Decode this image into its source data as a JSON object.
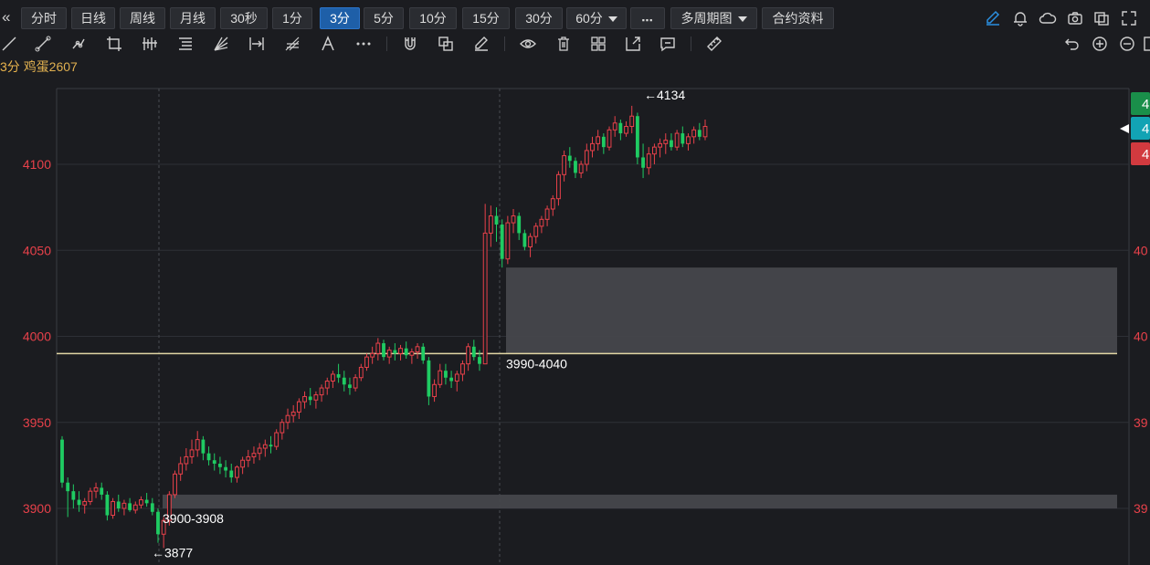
{
  "toolbar": {
    "periods": [
      {
        "label": "分时"
      },
      {
        "label": "日线"
      },
      {
        "label": "周线"
      },
      {
        "label": "月线"
      },
      {
        "label": "30秒"
      },
      {
        "label": "1分"
      },
      {
        "label": "3分",
        "active": true
      },
      {
        "label": "5分"
      },
      {
        "label": "10分"
      },
      {
        "label": "15分"
      },
      {
        "label": "30分"
      },
      {
        "label": "60分"
      }
    ],
    "more_label": "▪▪▪",
    "multi_period_label": "多周期图",
    "contract_info_label": "合约资料"
  },
  "symbol": {
    "period": "3分",
    "name": "鸡蛋2607"
  },
  "colors": {
    "background": "#1b1c20",
    "up": "#e8414a",
    "down": "#1fcb62",
    "grid": "#2e3036",
    "accent": "#1e5fa8",
    "zone": "#46474c",
    "level_line": "#e2d6a4",
    "price_text": "#e8414a"
  },
  "icons": {
    "drawing": [
      "line-tool-icon",
      "ray-tool-icon",
      "polyline-tool-icon",
      "crop-tool-icon",
      "bars-tool-icon",
      "fib-tool-icon",
      "fan-tool-icon",
      "measure-range-icon",
      "pitchfork-icon",
      "text-tool-icon",
      "more-tools-icon",
      "magnet-icon",
      "copy-icon",
      "eraser-icon",
      "eye-icon",
      "trash-icon",
      "layers-icon",
      "export-icon",
      "comment-icon",
      "ruler-icon"
    ],
    "right": [
      "pencil-icon",
      "bell-icon",
      "cloud-icon",
      "camera-icon",
      "window-icon",
      "expand-icon"
    ]
  },
  "chart_data": {
    "type": "candlestick",
    "y_ticks": [
      "4100",
      "4050",
      "4000",
      "3950",
      "3900"
    ],
    "ylim": [
      3867,
      4144
    ],
    "zones": [
      {
        "label": "3990-4040",
        "low": 3990,
        "high": 4040
      },
      {
        "label": "3900-3908",
        "low": 3900,
        "high": 3908
      }
    ],
    "level_line": 3990,
    "annotations": [
      {
        "label": "←4134",
        "value": 4134
      },
      {
        "label": "←3877",
        "value": 3877
      }
    ],
    "right_axis_partial": [
      "40",
      "40",
      "39",
      "39"
    ],
    "price_tags": [
      {
        "label": "4",
        "color": "#1a8f4a"
      },
      {
        "label": "4",
        "color": "#12a3b4"
      },
      {
        "label": "4",
        "color": "#d23a3f"
      }
    ],
    "candles": [
      [
        3940,
        3942,
        3912,
        3915
      ],
      [
        3915,
        3918,
        3895,
        3910
      ],
      [
        3910,
        3914,
        3900,
        3905
      ],
      [
        3905,
        3910,
        3898,
        3902
      ],
      [
        3902,
        3906,
        3897,
        3904
      ],
      [
        3904,
        3912,
        3902,
        3910
      ],
      [
        3910,
        3915,
        3906,
        3912
      ],
      [
        3912,
        3915,
        3905,
        3908
      ],
      [
        3908,
        3910,
        3893,
        3896
      ],
      [
        3896,
        3906,
        3894,
        3904
      ],
      [
        3904,
        3908,
        3898,
        3900
      ],
      [
        3900,
        3905,
        3896,
        3903
      ],
      [
        3903,
        3906,
        3898,
        3899
      ],
      [
        3899,
        3904,
        3897,
        3902
      ],
      [
        3902,
        3907,
        3900,
        3905
      ],
      [
        3905,
        3909,
        3901,
        3903
      ],
      [
        3903,
        3906,
        3896,
        3898
      ],
      [
        3898,
        3900,
        3880,
        3885
      ],
      [
        3885,
        3895,
        3877,
        3893
      ],
      [
        3893,
        3910,
        3890,
        3908
      ],
      [
        3908,
        3922,
        3906,
        3920
      ],
      [
        3920,
        3930,
        3916,
        3926
      ],
      [
        3926,
        3935,
        3922,
        3930
      ],
      [
        3930,
        3940,
        3926,
        3934
      ],
      [
        3934,
        3945,
        3930,
        3940
      ],
      [
        3940,
        3942,
        3928,
        3932
      ],
      [
        3932,
        3936,
        3925,
        3928
      ],
      [
        3928,
        3932,
        3922,
        3926
      ],
      [
        3926,
        3930,
        3920,
        3924
      ],
      [
        3924,
        3928,
        3918,
        3922
      ],
      [
        3922,
        3926,
        3915,
        3918
      ],
      [
        3918,
        3925,
        3915,
        3924
      ],
      [
        3924,
        3930,
        3920,
        3928
      ],
      [
        3928,
        3934,
        3924,
        3930
      ],
      [
        3930,
        3936,
        3926,
        3932
      ],
      [
        3932,
        3938,
        3928,
        3935
      ],
      [
        3935,
        3940,
        3930,
        3937
      ],
      [
        3937,
        3942,
        3932,
        3936
      ],
      [
        3936,
        3946,
        3934,
        3944
      ],
      [
        3944,
        3952,
        3940,
        3950
      ],
      [
        3950,
        3958,
        3946,
        3954
      ],
      [
        3954,
        3960,
        3950,
        3956
      ],
      [
        3956,
        3964,
        3952,
        3962
      ],
      [
        3962,
        3968,
        3958,
        3965
      ],
      [
        3965,
        3970,
        3960,
        3963
      ],
      [
        3963,
        3968,
        3958,
        3966
      ],
      [
        3966,
        3972,
        3962,
        3970
      ],
      [
        3970,
        3976,
        3966,
        3974
      ],
      [
        3974,
        3980,
        3970,
        3978
      ],
      [
        3978,
        3984,
        3973,
        3976
      ],
      [
        3976,
        3980,
        3968,
        3972
      ],
      [
        3972,
        3976,
        3966,
        3970
      ],
      [
        3970,
        3978,
        3968,
        3976
      ],
      [
        3976,
        3984,
        3974,
        3982
      ],
      [
        3982,
        3990,
        3980,
        3988
      ],
      [
        3988,
        3994,
        3984,
        3990
      ],
      [
        3990,
        3999,
        3986,
        3996
      ],
      [
        3996,
        3998,
        3986,
        3988
      ],
      [
        3988,
        3994,
        3984,
        3992
      ],
      [
        3992,
        3996,
        3986,
        3990
      ],
      [
        3990,
        3995,
        3986,
        3993
      ],
      [
        3993,
        3997,
        3987,
        3989
      ],
      [
        3989,
        3993,
        3984,
        3991
      ],
      [
        3991,
        3996,
        3987,
        3994
      ],
      [
        3994,
        3996,
        3984,
        3986
      ],
      [
        3986,
        3988,
        3960,
        3965
      ],
      [
        3965,
        3975,
        3962,
        3972
      ],
      [
        3972,
        3984,
        3970,
        3980
      ],
      [
        3980,
        3984,
        3972,
        3976
      ],
      [
        3976,
        3980,
        3970,
        3974
      ],
      [
        3974,
        3980,
        3968,
        3978
      ],
      [
        3978,
        3986,
        3974,
        3984
      ],
      [
        3984,
        3996,
        3980,
        3994
      ],
      [
        3994,
        3998,
        3986,
        3988
      ],
      [
        3988,
        3992,
        3980,
        3984
      ],
      [
        3984,
        4077,
        3984,
        4060
      ],
      [
        4060,
        4076,
        4052,
        4070
      ],
      [
        4070,
        4075,
        4055,
        4065
      ],
      [
        4065,
        4068,
        4040,
        4045
      ],
      [
        4045,
        4070,
        4042,
        4066
      ],
      [
        4066,
        4074,
        4060,
        4070
      ],
      [
        4070,
        4072,
        4056,
        4060
      ],
      [
        4060,
        4062,
        4050,
        4052
      ],
      [
        4052,
        4060,
        4046,
        4058
      ],
      [
        4058,
        4066,
        4054,
        4064
      ],
      [
        4064,
        4070,
        4060,
        4068
      ],
      [
        4068,
        4076,
        4064,
        4074
      ],
      [
        4074,
        4082,
        4070,
        4080
      ],
      [
        4080,
        4096,
        4076,
        4094
      ],
      [
        4094,
        4108,
        4090,
        4105
      ],
      [
        4105,
        4110,
        4098,
        4102
      ],
      [
        4102,
        4104,
        4092,
        4095
      ],
      [
        4095,
        4102,
        4092,
        4100
      ],
      [
        4100,
        4112,
        4096,
        4108
      ],
      [
        4108,
        4116,
        4104,
        4112
      ],
      [
        4112,
        4120,
        4108,
        4116
      ],
      [
        4116,
        4118,
        4106,
        4110
      ],
      [
        4110,
        4122,
        4108,
        4120
      ],
      [
        4120,
        4128,
        4116,
        4124
      ],
      [
        4124,
        4126,
        4114,
        4118
      ],
      [
        4118,
        4125,
        4116,
        4122
      ],
      [
        4122,
        4134,
        4118,
        4128
      ],
      [
        4128,
        4130,
        4100,
        4104
      ],
      [
        4104,
        4112,
        4092,
        4098
      ],
      [
        4098,
        4110,
        4094,
        4106
      ],
      [
        4106,
        4112,
        4100,
        4110
      ],
      [
        4110,
        4115,
        4104,
        4112
      ],
      [
        4112,
        4118,
        4106,
        4114
      ],
      [
        4114,
        4118,
        4108,
        4110
      ],
      [
        4110,
        4120,
        4108,
        4118
      ],
      [
        4118,
        4122,
        4110,
        4112
      ],
      [
        4112,
        4118,
        4108,
        4116
      ],
      [
        4116,
        4122,
        4112,
        4120
      ],
      [
        4120,
        4124,
        4114,
        4116
      ],
      [
        4116,
        4126,
        4114,
        4122
      ]
    ]
  }
}
